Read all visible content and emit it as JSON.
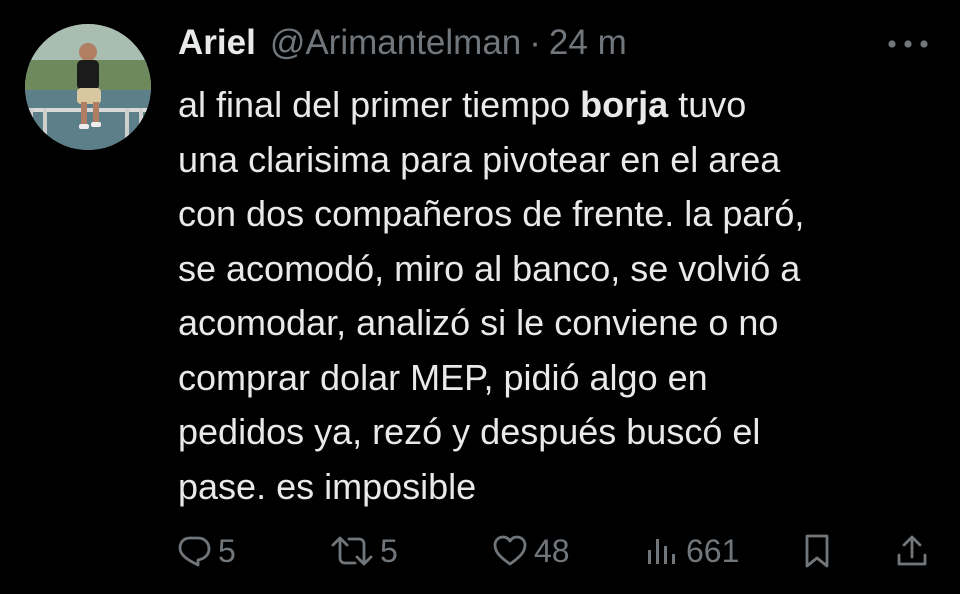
{
  "tweet": {
    "author": {
      "name": "Ariel",
      "handle": "@Arimantelman",
      "separator": "·",
      "time": "24 m",
      "avatar_icon": "user-photo-avatar"
    },
    "text_lines": [
      {
        "before": "al final del primer tiempo ",
        "bold": "borja",
        "after": " tuvo"
      },
      {
        "before": "una clarisima para pivotear en el area",
        "bold": "",
        "after": ""
      },
      {
        "before": "con dos compañeros de frente. la paró,",
        "bold": "",
        "after": ""
      },
      {
        "before": "se acomodó, miro al banco, se volvió a",
        "bold": "",
        "after": ""
      },
      {
        "before": "acomodar, analizó si le conviene o no",
        "bold": "",
        "after": ""
      },
      {
        "before": "comprar dolar MEP, pidió algo en",
        "bold": "",
        "after": ""
      },
      {
        "before": "pedidos ya, rezó y después buscó el",
        "bold": "",
        "after": ""
      },
      {
        "before": "pase. es imposible",
        "bold": "",
        "after": ""
      }
    ],
    "actions": {
      "replies": "5",
      "retweets": "5",
      "likes": "48",
      "views": "661"
    }
  },
  "colors": {
    "background": "#000000",
    "text_primary": "#e7e9ea",
    "text_secondary": "#71767b"
  }
}
